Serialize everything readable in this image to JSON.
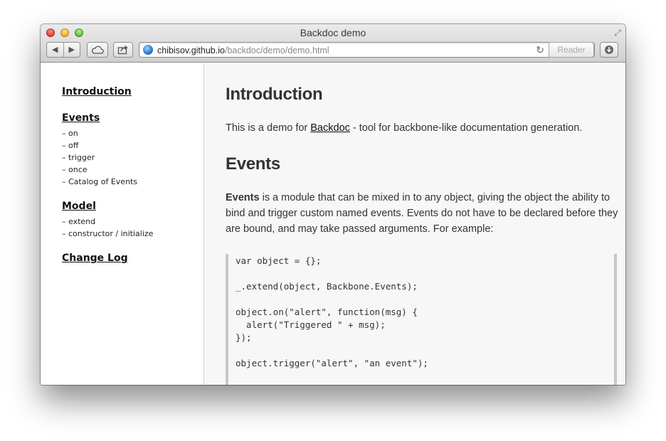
{
  "window": {
    "title": "Backdoc demo"
  },
  "toolbar": {
    "back_icon": "◀",
    "forward_icon": "▶",
    "url_host": "chibisov.github.io",
    "url_path": "/backdoc/demo/demo.html",
    "reader_label": "Reader"
  },
  "sidebar": {
    "sections": [
      {
        "title": "Introduction",
        "items": []
      },
      {
        "title": "Events",
        "items": [
          "on",
          "off",
          "trigger",
          "once",
          "Catalog of Events"
        ]
      },
      {
        "title": "Model",
        "items": [
          "extend",
          "constructor / initialize"
        ]
      },
      {
        "title": "Change Log",
        "items": []
      }
    ]
  },
  "main": {
    "intro_heading": "Introduction",
    "intro_text_before": "This is a demo for ",
    "intro_link": "Backdoc",
    "intro_text_after": " - tool for backbone-like documentation generation.",
    "events_heading": "Events",
    "events_bold": "Events",
    "events_text": " is a module that can be mixed in to any object, giving the object the ability to bind and trigger custom named events. Events do not have to be declared before they are bound, and may take passed arguments. For example:",
    "code_lines": [
      "var object = {};",
      "",
      "_.extend(object, Backbone.Events);",
      "",
      "object.on(\"alert\", function(msg) {",
      "  alert(\"Triggered \" + msg);",
      "});",
      "",
      "object.trigger(\"alert\", \"an event\");"
    ]
  }
}
